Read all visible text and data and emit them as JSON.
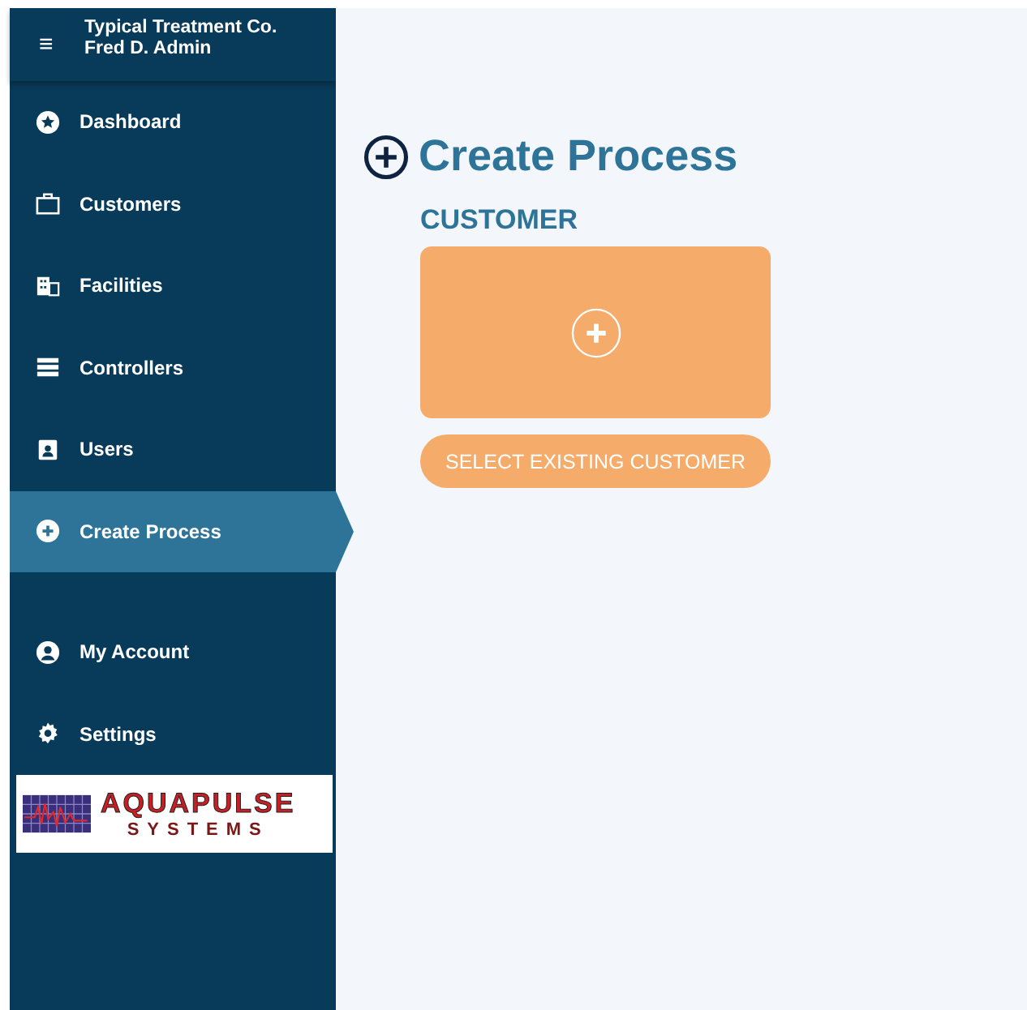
{
  "header": {
    "menu_glyph": "≡",
    "company": "Typical Treatment Co.",
    "user": "Fred D. Admin"
  },
  "nav": [
    {
      "label": "Dashboard",
      "selected": false
    },
    {
      "label": "Customers",
      "selected": false
    },
    {
      "label": "Facilities",
      "selected": false
    },
    {
      "label": "Controllers",
      "selected": false
    },
    {
      "label": "Users",
      "selected": false
    },
    {
      "label": "Create Process",
      "selected": true
    }
  ],
  "account_nav": [
    {
      "label": "My Account",
      "selected": false
    },
    {
      "label": "Settings",
      "selected": false
    }
  ],
  "logo": {
    "name": "AQUAPULSE",
    "tagline": "SYSTEMS"
  },
  "page": {
    "title": "Create Process",
    "section": "CUSTOMER",
    "select_button": "SELECT EXISTING CUSTOMER"
  }
}
